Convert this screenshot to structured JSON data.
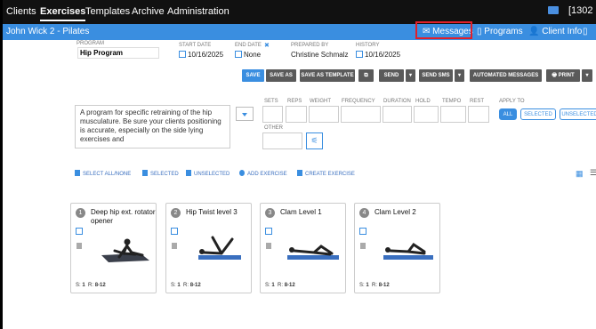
{
  "topnav": {
    "items": [
      "Clients",
      "Exercises",
      "Templates",
      "Archive",
      "Administration"
    ],
    "account": "[1302"
  },
  "header": {
    "title": "John Wick 2 - Pilates",
    "messages": "Messages",
    "programs": "Programs",
    "client_info": "Client Info"
  },
  "program": {
    "label": "PROGRAM",
    "name": "Hip Program",
    "start_label": "START DATE",
    "start": "10/16/2025",
    "end_label": "END DATE",
    "end": "None",
    "prepared_label": "PREPARED BY",
    "prepared": "Christine Schmalz",
    "history_label": "HISTORY",
    "history": "10/16/2025"
  },
  "toolbar": {
    "save": "SAVE",
    "save_as": "SAVE AS",
    "save_template": "SAVE AS TEMPLATE",
    "send": "SEND",
    "send_sms": "SEND SMS",
    "automated": "AUTOMATED MESSAGES",
    "print": "PRINT"
  },
  "description": "A program for specific retraining of the hip musculature. Be sure your clients positioning is accurate, especially on the side lying exercises and",
  "fields": {
    "sets": "SETS",
    "reps": "REPS",
    "weight": "WEIGHT",
    "frequency": "FREQUENCY",
    "duration": "DURATION",
    "hold": "HOLD",
    "tempo": "TEMPO",
    "rest": "REST",
    "apply": "APPLY TO",
    "other": "OTHER",
    "all": "ALL",
    "selected": "SELECTED",
    "unselected": "UNSELECTED"
  },
  "actions": {
    "select_all": "SELECT ALL/NONE",
    "selected": "SELECTED",
    "unselected": "UNSELECTED",
    "add": "ADD EXERCISE",
    "create": "CREATE EXERCISE"
  },
  "cards": [
    {
      "num": "1",
      "title": "Deep hip ext. rotator opener",
      "sets": "1",
      "reps": "8-12"
    },
    {
      "num": "2",
      "title": "Hip Twist level 3",
      "sets": "1",
      "reps": "8-12"
    },
    {
      "num": "3",
      "title": "Clam Level 1",
      "sets": "1",
      "reps": "8-12"
    },
    {
      "num": "4",
      "title": "Clam Level 2",
      "sets": "1",
      "reps": "8-12"
    }
  ],
  "colors": {
    "accent": "#3a8ee0",
    "nav_bg": "#111111",
    "highlight": "#e0202a"
  }
}
